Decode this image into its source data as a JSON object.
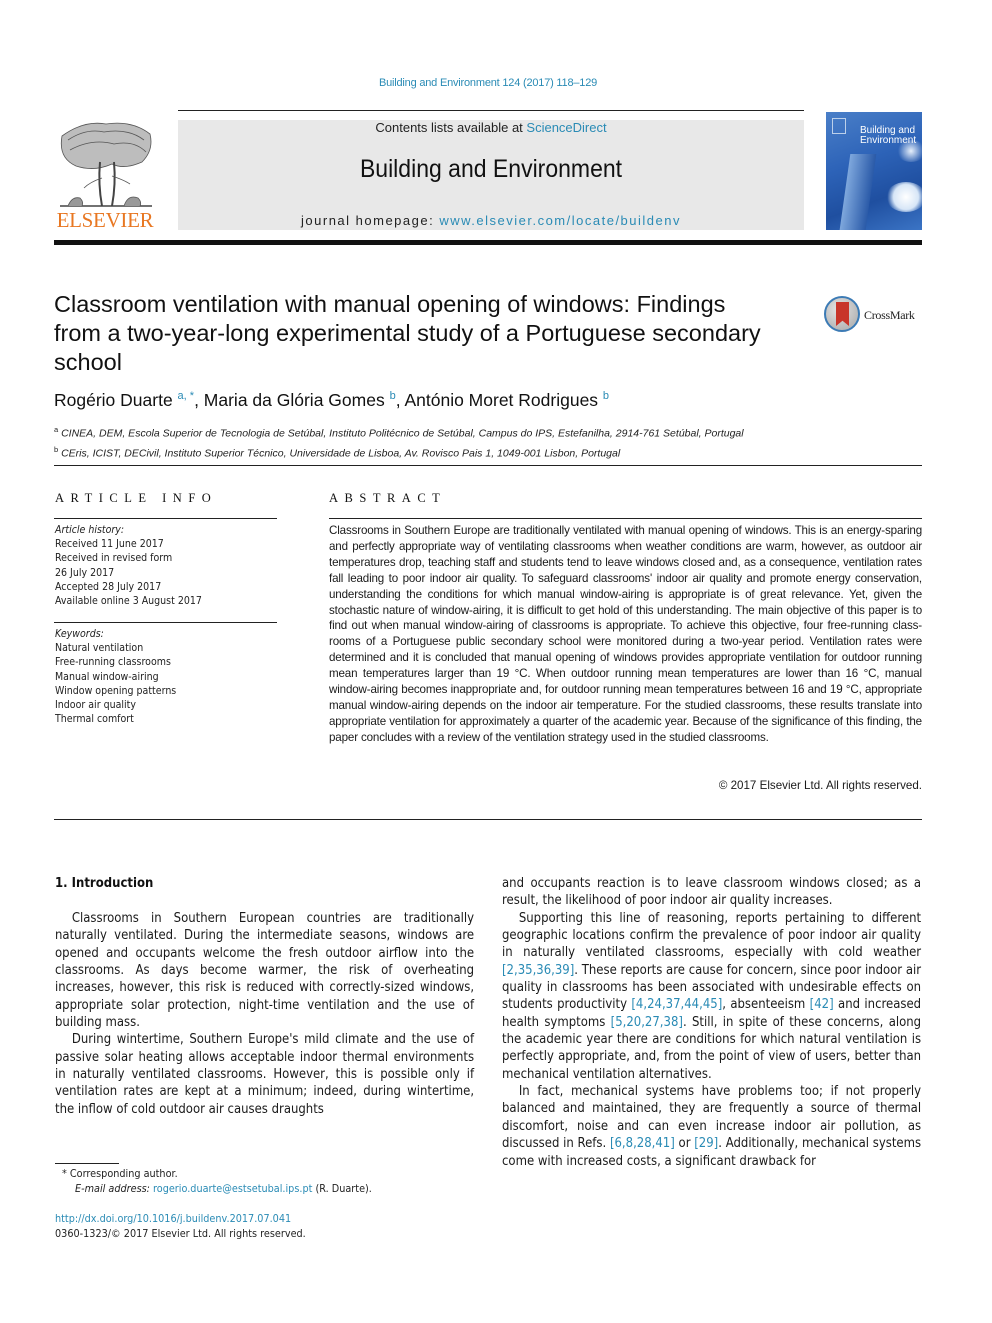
{
  "header": {
    "citation": "Building and Environment 124 (2017) 118–129",
    "contents_prefix": "Contents lists available at ",
    "contents_link": "ScienceDirect",
    "journal_name": "Building and Environment",
    "homepage_prefix": "journal homepage: ",
    "homepage_link": "www.elsevier.com/locate/buildenv",
    "publisher_logo": "ELSEVIER",
    "cover_title_line1": "Building and",
    "cover_title_line2": "Environment",
    "crossmark_label": "CrossMark"
  },
  "colors": {
    "link": "#2a8bb5",
    "elsevier_orange": "#e87722",
    "masthead_bg": "#e8e8e8",
    "crossmark_red": "#c8352a"
  },
  "article": {
    "title_lines": [
      "Classroom ventilation with manual opening of windows: Findings",
      "from a two-year-long experimental study of a Portuguese secondary",
      "school"
    ],
    "authors": [
      {
        "name": "Rogério Duarte",
        "sup": "a, *"
      },
      {
        "name": "Maria da Glória Gomes",
        "sup": "b"
      },
      {
        "name": "António Moret Rodrigues",
        "sup": "b"
      }
    ],
    "affiliations": [
      {
        "mark": "a",
        "text": "CINEA, DEM, Escola Superior de Tecnologia de Setúbal, Instituto Politécnico de Setúbal, Campus do IPS, Estefanilha, 2914-761 Setúbal, Portugal"
      },
      {
        "mark": "b",
        "text": "CEris, ICIST, DECivil, Instituto Superior Técnico, Universidade de Lisboa, Av. Rovisco Pais 1, 1049-001 Lisbon, Portugal"
      }
    ]
  },
  "article_info": {
    "heading": "ARTICLE INFO",
    "history_label": "Article history:",
    "history": [
      "Received 11 June 2017",
      "Received in revised form",
      "26 July 2017",
      "Accepted 28 July 2017",
      "Available online 3 August 2017"
    ],
    "keywords_label": "Keywords:",
    "keywords": [
      "Natural ventilation",
      "Free-running classrooms",
      "Manual window-airing",
      "Window opening patterns",
      "Indoor air quality",
      "Thermal comfort"
    ]
  },
  "abstract": {
    "heading": "ABSTRACT",
    "text": "Classrooms in Southern Europe are traditionally ventilated with manual opening of windows. This is an energy-sparing and perfectly appropriate way of ventilating classrooms when weather conditions are warm, however, as outdoor air temperatures drop, teaching staff and students tend to leave windows closed and, as a consequence, ventilation rates fall leading to poor indoor air quality. To safeguard classrooms' indoor air quality and promote energy conservation, understanding the conditions for which manual window-airing is appropriate is of great relevance. Yet, given the stochastic nature of window-airing, it is difficult to get hold of this understanding. The main objective of this paper is to find out when manual window-airing of classrooms is appropriate. To achieve this objective, four free-running class-rooms of a Portuguese public secondary school were monitored during a two-year period. Ventilation rates were determined and it is concluded that manual opening of windows provides appropriate ventilation for outdoor running mean temperatures larger than 19 °C. When outdoor running mean temperatures are lower than 16 °C, manual window-airing becomes inappropriate and, for outdoor running mean temperatures between 16 and 19 °C, appropriate manual window-airing depends on the indoor air temperature. For the studied classrooms, these results translate into appropriate ventilation for approximately a quarter of the academic year. Because of the significance of this finding, the paper concludes with a review of the ventilation strategy used in the studied classrooms.",
    "copyright": "© 2017 Elsevier Ltd. All rights reserved."
  },
  "body": {
    "section_heading": "1.  Introduction",
    "left_paragraphs": [
      "Classrooms in Southern European countries are traditionally naturally ventilated. During the intermediate seasons, windows are opened and occupants welcome the fresh outdoor airflow into the classrooms. As days become warmer, the risk of overheating increases, however, this risk is reduced with correctly-sized windows, appropriate solar protection, night-time ventilation and the use of building mass.",
      "During wintertime, Southern Europe's mild climate and the use of passive solar heating allows acceptable indoor thermal environments in naturally ventilated classrooms. However, this is possible only if ventilation rates are kept at a minimum; indeed, during wintertime, the inflow of cold outdoor air causes draughts"
    ],
    "right": {
      "p1": "and occupants reaction is to leave classroom windows closed; as a result, the likelihood of poor indoor air quality increases.",
      "p2_a": "Supporting this line of reasoning, reports pertaining to different geographic locations confirm the prevalence of poor indoor air quality in naturally ventilated classrooms, especially with cold weather ",
      "p2_ref1": "[2,35,36,39]",
      "p2_b": ". These reports are cause for concern, since poor indoor air quality in classrooms has been associated with undesirable effects on students productivity ",
      "p2_ref2": "[4,24,37,44,45]",
      "p2_c": ", absenteeism ",
      "p2_ref3": "[42]",
      "p2_d": " and increased health symptoms ",
      "p2_ref4": "[5,20,27,38]",
      "p2_e": ". Still, in spite of these concerns, along the academic year there are conditions for which natural ventilation is perfectly appropriate, and, from the point of view of users, better than mechanical ventilation alternatives.",
      "p3_a": "In fact, mechanical systems have problems too; if not properly balanced and maintained, they are frequently a source of thermal discomfort, noise and can even increase indoor air pollution, as discussed in Refs. ",
      "p3_ref1": "[6,8,28,41]",
      "p3_b": " or ",
      "p3_ref2": "[29]",
      "p3_c": ". Additionally, mechanical systems come with increased costs, a significant drawback for"
    }
  },
  "footnotes": {
    "corresponding": "*  Corresponding author.",
    "email_label": "E-mail address: ",
    "email": "rogerio.duarte@estsetubal.ips.pt",
    "email_suffix": " (R. Duarte).",
    "doi": "http://dx.doi.org/10.1016/j.buildenv.2017.07.041",
    "issn": "0360-1323/© 2017 Elsevier Ltd. All rights reserved."
  }
}
